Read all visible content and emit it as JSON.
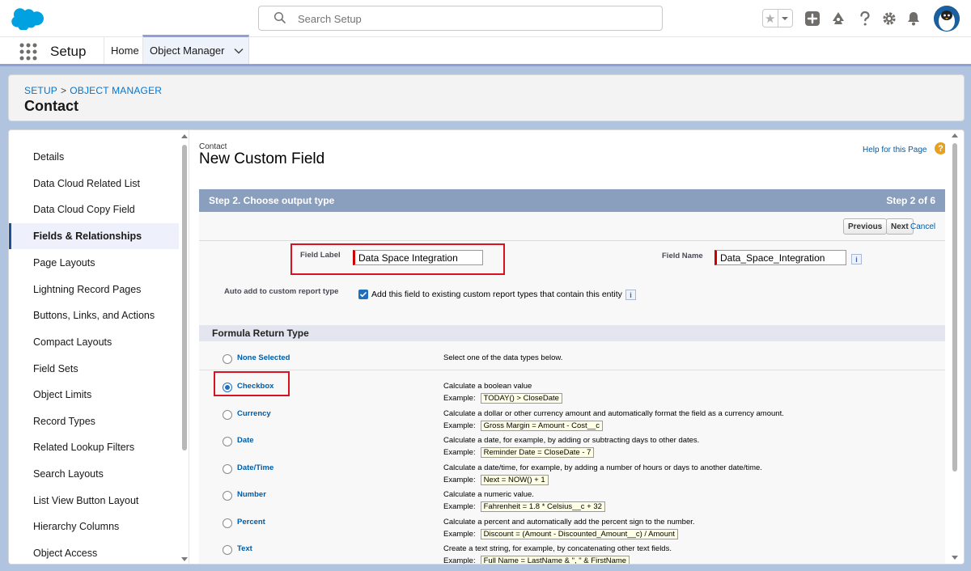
{
  "header": {
    "search_placeholder": "Search Setup",
    "icons": [
      "favorites-star-icon",
      "add-icon",
      "trailhead-icon",
      "help-icon",
      "gear-icon",
      "notification-bell-icon",
      "user-avatar"
    ],
    "brand_color": "#00a1e0"
  },
  "context": {
    "app_name": "Setup",
    "tabs": [
      {
        "label": "Home"
      },
      {
        "label": "Object Manager"
      }
    ]
  },
  "page_header": {
    "breadcrumb_setup": "SETUP",
    "breadcrumb_sep": ">",
    "breadcrumb_om": "OBJECT MANAGER",
    "title": "Contact"
  },
  "sidebar": {
    "items": [
      {
        "label": "Details"
      },
      {
        "label": "Data Cloud Related List"
      },
      {
        "label": "Data Cloud Copy Field"
      },
      {
        "label": "Fields & Relationships",
        "active": true
      },
      {
        "label": "Page Layouts"
      },
      {
        "label": "Lightning Record Pages"
      },
      {
        "label": "Buttons, Links, and Actions"
      },
      {
        "label": "Compact Layouts"
      },
      {
        "label": "Field Sets"
      },
      {
        "label": "Object Limits"
      },
      {
        "label": "Record Types"
      },
      {
        "label": "Related Lookup Filters"
      },
      {
        "label": "Search Layouts"
      },
      {
        "label": "List View Button Layout"
      },
      {
        "label": "Hierarchy Columns"
      },
      {
        "label": "Object Access"
      }
    ]
  },
  "content": {
    "object_name": "Contact",
    "title": "New Custom Field",
    "help_link": "Help for this Page",
    "help_icon_glyph": "?",
    "step_title": "Step 2. Choose output type",
    "step_count": "Step 2 of 6",
    "buttons": {
      "previous": "Previous",
      "next": "Next",
      "cancel": "Cancel"
    },
    "field_label_label": "Field Label",
    "field_label_value": "Data Space Integration",
    "field_name_label": "Field Name",
    "field_name_value": "Data_Space_Integration",
    "info_glyph": "i",
    "auto_add_label": "Auto add to custom report type",
    "auto_add_text": "Add this field to existing custom report types that contain this entity",
    "auto_add_checked": true,
    "section_title": "Formula Return Type",
    "example_prefix": "Example:",
    "options": [
      {
        "label": "None Selected",
        "desc": "Select one of the data types below.",
        "example": "",
        "selected": false
      },
      {
        "label": "Checkbox",
        "desc": "Calculate a boolean value",
        "example": "TODAY() > CloseDate",
        "selected": true
      },
      {
        "label": "Currency",
        "desc": "Calculate a dollar or other currency amount and automatically format the field as a currency amount.",
        "example": "Gross Margin = Amount - Cost__c",
        "selected": false
      },
      {
        "label": "Date",
        "desc": "Calculate a date, for example, by adding or subtracting days to other dates.",
        "example": "Reminder Date = CloseDate - 7",
        "selected": false
      },
      {
        "label": "Date/Time",
        "desc": "Calculate a date/time, for example, by adding a number of hours or days to another date/time.",
        "example": "Next = NOW() + 1",
        "selected": false
      },
      {
        "label": "Number",
        "desc": "Calculate a numeric value.",
        "example": "Fahrenheit = 1.8 * Celsius__c + 32",
        "selected": false
      },
      {
        "label": "Percent",
        "desc": "Calculate a percent and automatically add the percent sign to the number.",
        "example": "Discount = (Amount - Discounted_Amount__c) / Amount",
        "selected": false
      },
      {
        "label": "Text",
        "desc": "Create a text string, for example, by concatenating other text fields.",
        "example": "Full Name = LastName & \", \" & FirstName",
        "selected": false
      }
    ]
  }
}
